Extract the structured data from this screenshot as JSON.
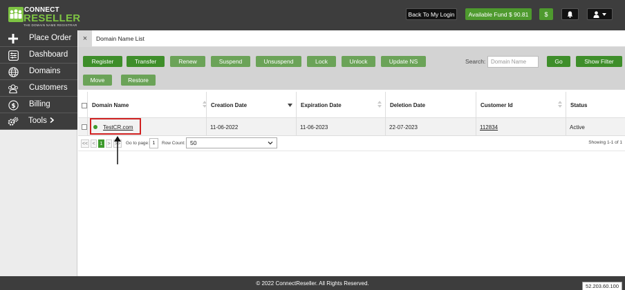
{
  "header": {
    "logo_line1": "CONNECT",
    "logo_line2": "RESELLER",
    "logo_tagline": "THE DOMAIN NAME REGISTRAR",
    "back_label": "Back To My Login",
    "fund_label": "Available Fund",
    "fund_amount": "$ 90.81",
    "dollar_label": "$",
    "bell_icon": "bell-icon",
    "user_icon": "user-icon"
  },
  "sidebar": {
    "items": [
      {
        "label": "Place Order",
        "icon": "plus-icon"
      },
      {
        "label": "Dashboard",
        "icon": "sliders-icon"
      },
      {
        "label": "Domains",
        "icon": "globe-icon"
      },
      {
        "label": "Customers",
        "icon": "users-icon"
      },
      {
        "label": "Billing",
        "icon": "dollar-circle-icon"
      },
      {
        "label": "Tools",
        "icon": "gears-icon"
      }
    ]
  },
  "tab": {
    "close": "×",
    "label": "Domain Name List"
  },
  "toolbar": {
    "buttons_row1": [
      "Register",
      "Transfer",
      "Renew",
      "Suspend",
      "Unsuspend",
      "Lock",
      "Unlock",
      "Update NS"
    ],
    "buttons_row2": [
      "Move",
      "Restore"
    ],
    "search_label": "Search:",
    "search_placeholder": "Domain Name",
    "go_label": "Go",
    "filter_label": "Show Filter"
  },
  "table": {
    "columns": [
      "Domain Name",
      "Creation Date",
      "Expiration Date",
      "Deletion Date",
      "Customer Id",
      "Status"
    ],
    "rows": [
      {
        "domain": "TestCR.com",
        "creation": "11-06-2022",
        "expiration": "11-06-2023",
        "deletion": "22-07-2023",
        "customer_id": "112834",
        "status": "Active"
      }
    ]
  },
  "pager": {
    "first": "<<",
    "prev": "<",
    "page": "1",
    "next": ">",
    "last": ">>",
    "goto_label": "Go to page:",
    "goto_value": "1",
    "rowcount_label": "Row Count:",
    "rowcount_value": "50",
    "showing": "Showing 1-1 of 1"
  },
  "footer": {
    "copyright": "© 2022 ConnectReseller. All Rights Reserved.",
    "ip": "52.203.60.100"
  },
  "colors": {
    "header_bg": "#3d3d3d",
    "accent_green": "#3e8e2a",
    "light_green": "#6ba358",
    "highlight_red": "#d02020"
  }
}
